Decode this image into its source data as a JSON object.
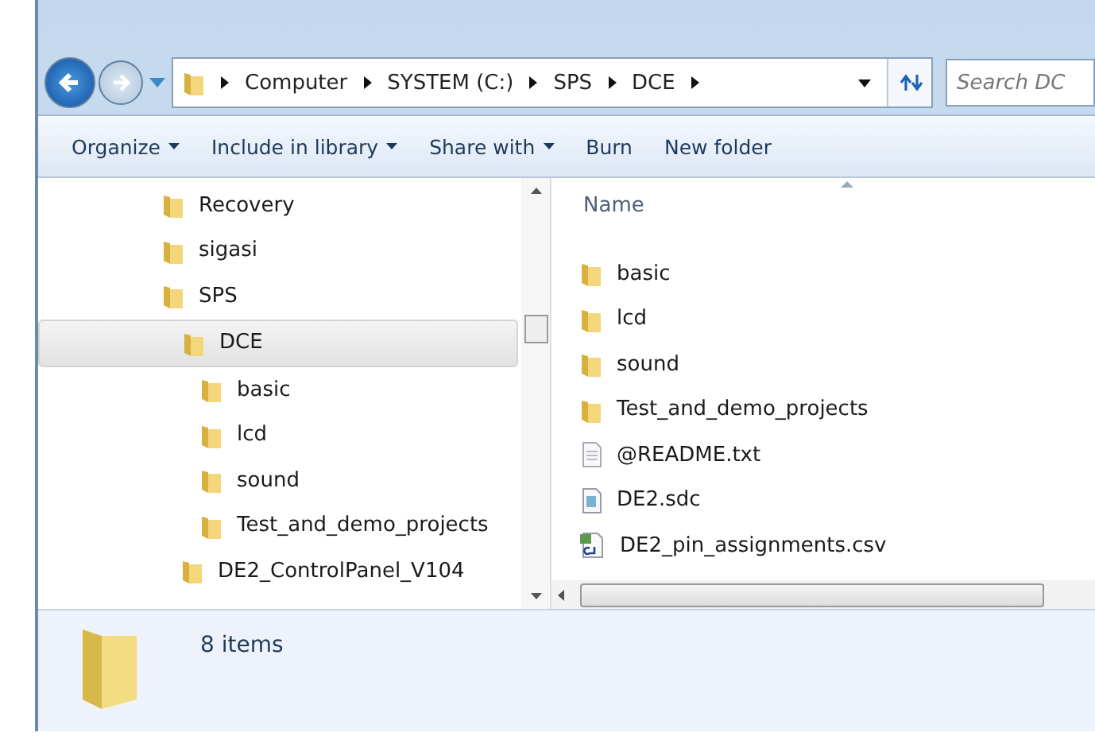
{
  "address_bar": {
    "path": [
      "Computer",
      "SYSTEM (C:)",
      "SPS",
      "DCE"
    ],
    "search_placeholder": "Search DC"
  },
  "toolbar": [
    {
      "label": "Organize",
      "dropdown": true
    },
    {
      "label": "Include in library",
      "dropdown": true
    },
    {
      "label": "Share with",
      "dropdown": true
    },
    {
      "label": "Burn",
      "dropdown": false
    },
    {
      "label": "New folder",
      "dropdown": false
    }
  ],
  "tree": [
    {
      "label": "Recovery",
      "selected": false
    },
    {
      "label": "sigasi",
      "selected": false
    },
    {
      "label": "SPS",
      "selected": false,
      "children": [
        {
          "label": "DCE",
          "selected": true,
          "children": [
            {
              "label": "basic",
              "selected": false
            },
            {
              "label": "lcd",
              "selected": false
            },
            {
              "label": "sound",
              "selected": false
            },
            {
              "label": "Test_and_demo_projects",
              "selected": false
            }
          ]
        },
        {
          "label": "DE2_ControlPanel_V104",
          "selected": false
        }
      ]
    }
  ],
  "file_list": {
    "column": "Name",
    "files": [
      {
        "name": "basic",
        "kind": "folder"
      },
      {
        "name": "lcd",
        "kind": "folder"
      },
      {
        "name": "sound",
        "kind": "folder"
      },
      {
        "name": "Test_and_demo_projects",
        "kind": "folder"
      },
      {
        "name": "@README.txt",
        "kind": "text"
      },
      {
        "name": "DE2.sdc",
        "kind": "sdc"
      },
      {
        "name": "DE2_pin_assignments.csv",
        "kind": "csv"
      }
    ]
  },
  "status_bar": {
    "count": "8 items"
  }
}
